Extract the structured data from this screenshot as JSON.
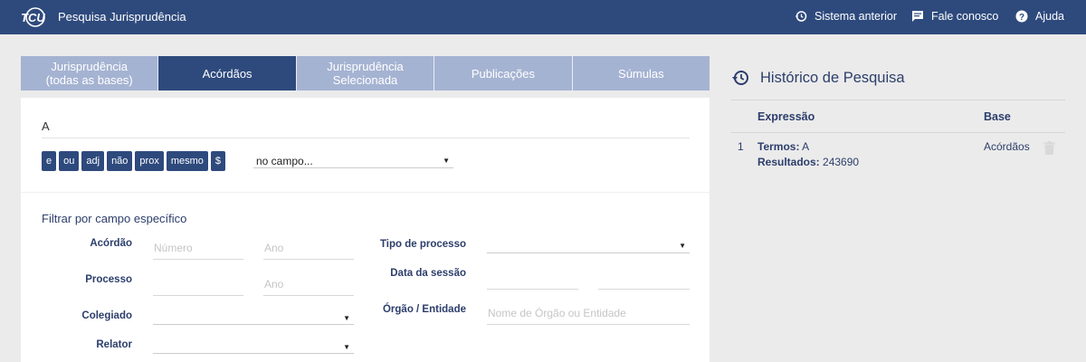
{
  "header": {
    "title": "Pesquisa Jurisprudência",
    "nav": [
      {
        "label": "Sistema anterior",
        "icon": "history-icon"
      },
      {
        "label": "Fale conosco",
        "icon": "chat-icon"
      },
      {
        "label": "Ajuda",
        "icon": "help-icon"
      }
    ],
    "logo": "TCU"
  },
  "tabs": [
    {
      "line1": "Jurisprudência",
      "line2": "(todas as bases)"
    },
    {
      "line1": "Acórdãos",
      "line2": ""
    },
    {
      "line1": "Jurisprudência",
      "line2": "Selecionada"
    },
    {
      "line1": "Publicações",
      "line2": ""
    },
    {
      "line1": "Súmulas",
      "line2": ""
    }
  ],
  "active_tab": "Acórdãos",
  "search": {
    "value": "A",
    "operators": [
      "e",
      "ou",
      "adj",
      "não",
      "prox",
      "mesmo",
      "$"
    ],
    "field_select": "no campo..."
  },
  "filters": {
    "title": "Filtrar por campo específico",
    "acordao_label": "Acórdão",
    "numero_placeholder": "Número",
    "ano_placeholder": "Ano",
    "processo_label": "Processo",
    "colegiado_label": "Colegiado",
    "relator_label": "Relator",
    "tipo_processo_label": "Tipo de processo",
    "data_sessao_label": "Data da sessão",
    "orgao_label": "Órgão / Entidade",
    "orgao_placeholder": "Nome de Órgão ou Entidade"
  },
  "history": {
    "title": "Histórico de Pesquisa",
    "col_expressao": "Expressão",
    "col_base": "Base",
    "rows": [
      {
        "index": "1",
        "termos_label": "Termos:",
        "termos": "A",
        "resultados_label": "Resultados:",
        "resultados": "243690",
        "base": "Acórdãos"
      }
    ]
  },
  "colors": {
    "primary": "#2e4a7d",
    "tab_inactive": "#a5b3d2",
    "background": "#ebebeb"
  }
}
